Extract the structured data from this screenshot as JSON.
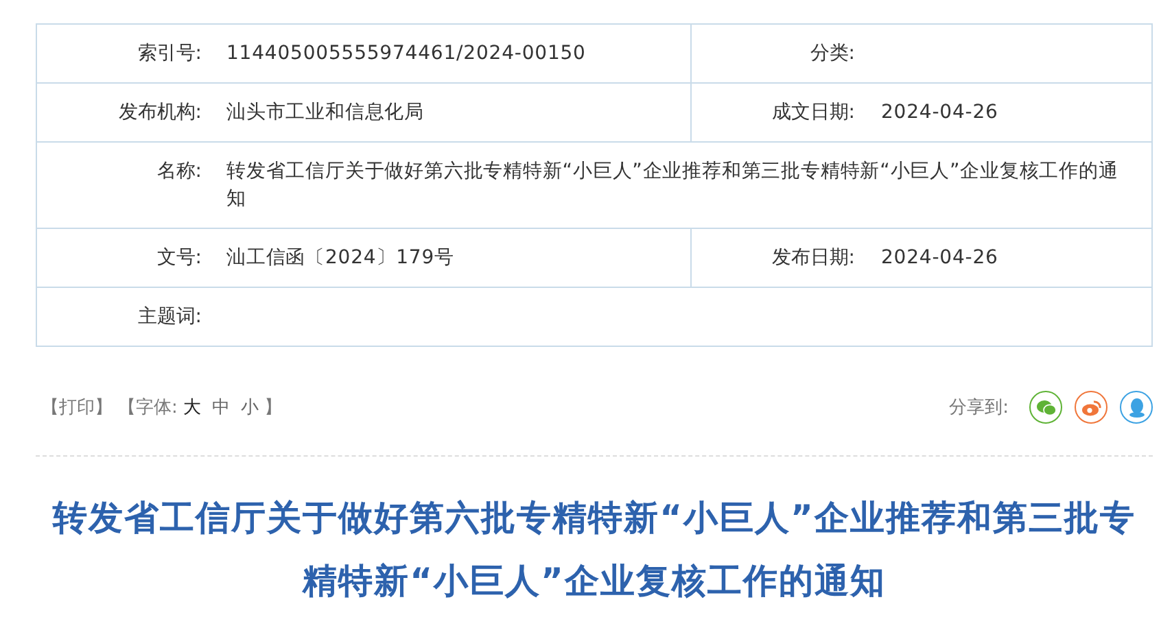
{
  "info_table": [
    {
      "cells": [
        {
          "label": "索引号:",
          "value": "114405005555974461/2024-00150"
        },
        {
          "label": "分类:"
        }
      ]
    },
    {
      "cells": [
        {
          "label": "发布机构:",
          "value": "汕头市工业和信息化局"
        },
        {
          "label": "成文日期:",
          "value": "2024-04-26"
        }
      ]
    },
    {
      "cells": [
        {
          "label": "名称:",
          "value": "转发省工信厅关于做好第六批专精特新“小巨人”企业推荐和第三批专精特新“小巨人”企业复核工作的通知"
        }
      ]
    },
    {
      "cells": [
        {
          "label": "文号:",
          "value": "汕工信函〔2024〕179号"
        },
        {
          "label": "发布日期:",
          "value": "2024-04-26"
        }
      ]
    },
    {
      "cells": [
        {
          "label": "主题词:"
        }
      ]
    }
  ],
  "toolbar": {
    "print": "【打印】",
    "font_label": "【字体:",
    "font_sizes": [
      {
        "label": "大",
        "selected": true
      },
      {
        "label": "中",
        "selected": false
      },
      {
        "label": "小",
        "selected": false
      }
    ],
    "font_close": "】",
    "share_label": "分享到:",
    "share": [
      {
        "kind": "wechat",
        "color": "#5fb336"
      },
      {
        "kind": "weibo",
        "color": "#f0763a"
      },
      {
        "kind": "qq",
        "color": "#3ca2e3"
      }
    ]
  },
  "article": {
    "title": "转发省工信厅关于做好第六批专精特新“小巨人”企业推荐和第三批专精特新“小巨人”企业复核工作的通知"
  }
}
